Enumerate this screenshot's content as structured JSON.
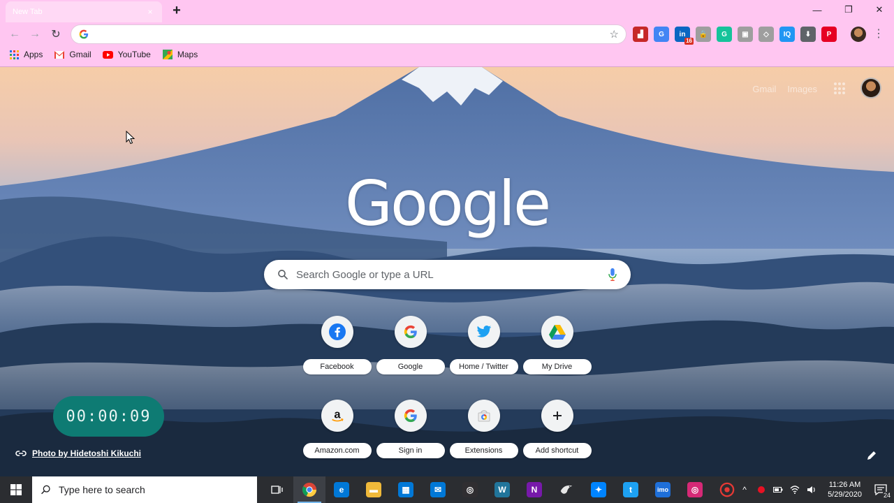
{
  "window": {
    "tab_title": "New Tab",
    "tab_close": "×",
    "new_tab": "+",
    "minimize": "—",
    "restore": "❐",
    "close": "✕"
  },
  "toolbar": {
    "back": "←",
    "forward": "→",
    "reload": "↻",
    "omnibox_value": "",
    "star": "☆",
    "menu": "⋮",
    "extensions": [
      {
        "icon": "chart-extension-icon",
        "glyph": "▟",
        "color": "#c62828"
      },
      {
        "icon": "translate-extension-icon",
        "glyph": "G",
        "color": "#4285f4"
      },
      {
        "icon": "linkedin-extension-icon",
        "glyph": "in",
        "color": "#0a66c2",
        "badge": "16"
      },
      {
        "icon": "lock-extension-icon",
        "glyph": "🔒",
        "color": "#9e9e9e"
      },
      {
        "icon": "grammarly-extension-icon",
        "glyph": "G",
        "color": "#15c39a"
      },
      {
        "icon": "puzzle-extension-icon",
        "glyph": "▣",
        "color": "#9e9e9e"
      },
      {
        "icon": "tag-extension-icon",
        "glyph": "◇",
        "color": "#9e9e9e"
      },
      {
        "icon": "iq-extension-icon",
        "glyph": "IQ",
        "color": "#2196f3"
      },
      {
        "icon": "download-extension-icon",
        "glyph": "⬇",
        "color": "#5f6368"
      },
      {
        "icon": "pinterest-extension-icon",
        "glyph": "P",
        "color": "#e60023"
      }
    ]
  },
  "bookmarks": [
    {
      "label": "Apps",
      "icon": "apps-grid-icon"
    },
    {
      "label": "Gmail",
      "icon": "gmail-icon"
    },
    {
      "label": "YouTube",
      "icon": "youtube-icon"
    },
    {
      "label": "Maps",
      "icon": "maps-icon"
    }
  ],
  "ntp": {
    "top_links": [
      "Gmail",
      "Images"
    ],
    "logo_text": "Google",
    "search_placeholder": "Search Google or type a URL",
    "shortcuts": [
      {
        "label": "Facebook",
        "icon": "facebook-icon"
      },
      {
        "label": "Google",
        "icon": "google-icon"
      },
      {
        "label": "Home / Twitter",
        "icon": "twitter-icon"
      },
      {
        "label": "My Drive",
        "icon": "google-drive-icon"
      },
      {
        "label": "Amazon.com",
        "icon": "amazon-icon"
      },
      {
        "label": "Sign in",
        "icon": "google-icon"
      },
      {
        "label": "Extensions",
        "icon": "chrome-web-store-icon"
      },
      {
        "label": "Add shortcut",
        "icon": "plus-icon"
      }
    ],
    "timer": "00:00:09",
    "attribution": "Photo by Hidetoshi Kikuchi"
  },
  "taskbar": {
    "search_placeholder": "Type here to search",
    "apps": [
      {
        "icon": "task-view-icon",
        "glyph": "⧉",
        "color": "transparent"
      },
      {
        "icon": "chrome-icon",
        "glyph": "◉",
        "color": "transparent",
        "active": true
      },
      {
        "icon": "edge-icon",
        "glyph": "e",
        "color": "#0078d7"
      },
      {
        "icon": "file-explorer-icon",
        "glyph": "▬",
        "color": "#f0b93a"
      },
      {
        "icon": "store-icon",
        "glyph": "▦",
        "color": "#0078d7"
      },
      {
        "icon": "mail-icon",
        "glyph": "✉",
        "color": "#0078d7"
      },
      {
        "icon": "obs-icon",
        "glyph": "◎",
        "color": "#302e31"
      },
      {
        "icon": "wordpress-icon",
        "glyph": "W",
        "color": "#21759b"
      },
      {
        "icon": "onenote-icon",
        "glyph": "N",
        "color": "#7719aa"
      },
      {
        "icon": "bird-app-icon",
        "glyph": "✣",
        "color": "transparent"
      },
      {
        "icon": "messenger-icon",
        "glyph": "✦",
        "color": "#0084ff"
      },
      {
        "icon": "twitter-app-icon",
        "glyph": "t",
        "color": "#1da1f2"
      },
      {
        "icon": "imo-icon",
        "glyph": "imo",
        "color": "#1e6fd9"
      },
      {
        "icon": "instagram-icon",
        "glyph": "◎",
        "color": "#d62976"
      },
      {
        "icon": "recorder-icon",
        "glyph": "●",
        "color": "transparent"
      }
    ],
    "time": "11:26 AM",
    "date": "5/29/2020",
    "notification_count": "24"
  }
}
